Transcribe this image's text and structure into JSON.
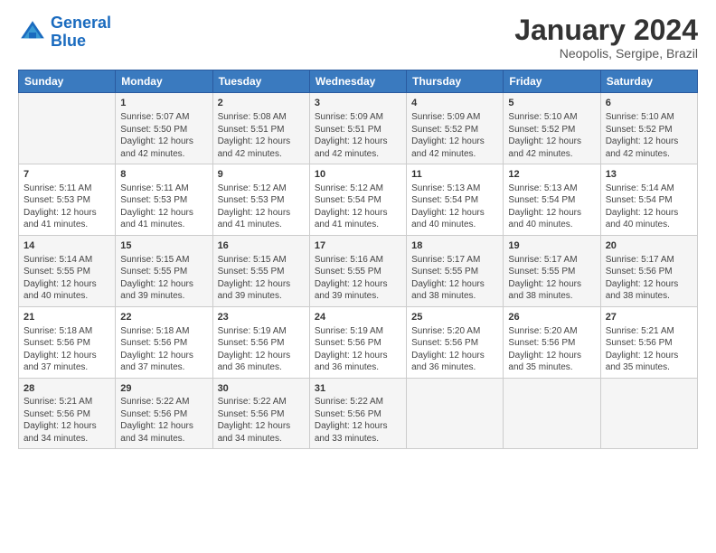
{
  "header": {
    "logo_line1": "General",
    "logo_line2": "Blue",
    "month": "January 2024",
    "location": "Neopolis, Sergipe, Brazil"
  },
  "weekdays": [
    "Sunday",
    "Monday",
    "Tuesday",
    "Wednesday",
    "Thursday",
    "Friday",
    "Saturday"
  ],
  "weeks": [
    [
      {
        "day": "",
        "info": ""
      },
      {
        "day": "1",
        "info": "Sunrise: 5:07 AM\nSunset: 5:50 PM\nDaylight: 12 hours\nand 42 minutes."
      },
      {
        "day": "2",
        "info": "Sunrise: 5:08 AM\nSunset: 5:51 PM\nDaylight: 12 hours\nand 42 minutes."
      },
      {
        "day": "3",
        "info": "Sunrise: 5:09 AM\nSunset: 5:51 PM\nDaylight: 12 hours\nand 42 minutes."
      },
      {
        "day": "4",
        "info": "Sunrise: 5:09 AM\nSunset: 5:52 PM\nDaylight: 12 hours\nand 42 minutes."
      },
      {
        "day": "5",
        "info": "Sunrise: 5:10 AM\nSunset: 5:52 PM\nDaylight: 12 hours\nand 42 minutes."
      },
      {
        "day": "6",
        "info": "Sunrise: 5:10 AM\nSunset: 5:52 PM\nDaylight: 12 hours\nand 42 minutes."
      }
    ],
    [
      {
        "day": "7",
        "info": "Sunrise: 5:11 AM\nSunset: 5:53 PM\nDaylight: 12 hours\nand 41 minutes."
      },
      {
        "day": "8",
        "info": "Sunrise: 5:11 AM\nSunset: 5:53 PM\nDaylight: 12 hours\nand 41 minutes."
      },
      {
        "day": "9",
        "info": "Sunrise: 5:12 AM\nSunset: 5:53 PM\nDaylight: 12 hours\nand 41 minutes."
      },
      {
        "day": "10",
        "info": "Sunrise: 5:12 AM\nSunset: 5:54 PM\nDaylight: 12 hours\nand 41 minutes."
      },
      {
        "day": "11",
        "info": "Sunrise: 5:13 AM\nSunset: 5:54 PM\nDaylight: 12 hours\nand 40 minutes."
      },
      {
        "day": "12",
        "info": "Sunrise: 5:13 AM\nSunset: 5:54 PM\nDaylight: 12 hours\nand 40 minutes."
      },
      {
        "day": "13",
        "info": "Sunrise: 5:14 AM\nSunset: 5:54 PM\nDaylight: 12 hours\nand 40 minutes."
      }
    ],
    [
      {
        "day": "14",
        "info": "Sunrise: 5:14 AM\nSunset: 5:55 PM\nDaylight: 12 hours\nand 40 minutes."
      },
      {
        "day": "15",
        "info": "Sunrise: 5:15 AM\nSunset: 5:55 PM\nDaylight: 12 hours\nand 39 minutes."
      },
      {
        "day": "16",
        "info": "Sunrise: 5:15 AM\nSunset: 5:55 PM\nDaylight: 12 hours\nand 39 minutes."
      },
      {
        "day": "17",
        "info": "Sunrise: 5:16 AM\nSunset: 5:55 PM\nDaylight: 12 hours\nand 39 minutes."
      },
      {
        "day": "18",
        "info": "Sunrise: 5:17 AM\nSunset: 5:55 PM\nDaylight: 12 hours\nand 38 minutes."
      },
      {
        "day": "19",
        "info": "Sunrise: 5:17 AM\nSunset: 5:55 PM\nDaylight: 12 hours\nand 38 minutes."
      },
      {
        "day": "20",
        "info": "Sunrise: 5:17 AM\nSunset: 5:56 PM\nDaylight: 12 hours\nand 38 minutes."
      }
    ],
    [
      {
        "day": "21",
        "info": "Sunrise: 5:18 AM\nSunset: 5:56 PM\nDaylight: 12 hours\nand 37 minutes."
      },
      {
        "day": "22",
        "info": "Sunrise: 5:18 AM\nSunset: 5:56 PM\nDaylight: 12 hours\nand 37 minutes."
      },
      {
        "day": "23",
        "info": "Sunrise: 5:19 AM\nSunset: 5:56 PM\nDaylight: 12 hours\nand 36 minutes."
      },
      {
        "day": "24",
        "info": "Sunrise: 5:19 AM\nSunset: 5:56 PM\nDaylight: 12 hours\nand 36 minutes."
      },
      {
        "day": "25",
        "info": "Sunrise: 5:20 AM\nSunset: 5:56 PM\nDaylight: 12 hours\nand 36 minutes."
      },
      {
        "day": "26",
        "info": "Sunrise: 5:20 AM\nSunset: 5:56 PM\nDaylight: 12 hours\nand 35 minutes."
      },
      {
        "day": "27",
        "info": "Sunrise: 5:21 AM\nSunset: 5:56 PM\nDaylight: 12 hours\nand 35 minutes."
      }
    ],
    [
      {
        "day": "28",
        "info": "Sunrise: 5:21 AM\nSunset: 5:56 PM\nDaylight: 12 hours\nand 34 minutes."
      },
      {
        "day": "29",
        "info": "Sunrise: 5:22 AM\nSunset: 5:56 PM\nDaylight: 12 hours\nand 34 minutes."
      },
      {
        "day": "30",
        "info": "Sunrise: 5:22 AM\nSunset: 5:56 PM\nDaylight: 12 hours\nand 34 minutes."
      },
      {
        "day": "31",
        "info": "Sunrise: 5:22 AM\nSunset: 5:56 PM\nDaylight: 12 hours\nand 33 minutes."
      },
      {
        "day": "",
        "info": ""
      },
      {
        "day": "",
        "info": ""
      },
      {
        "day": "",
        "info": ""
      }
    ]
  ]
}
